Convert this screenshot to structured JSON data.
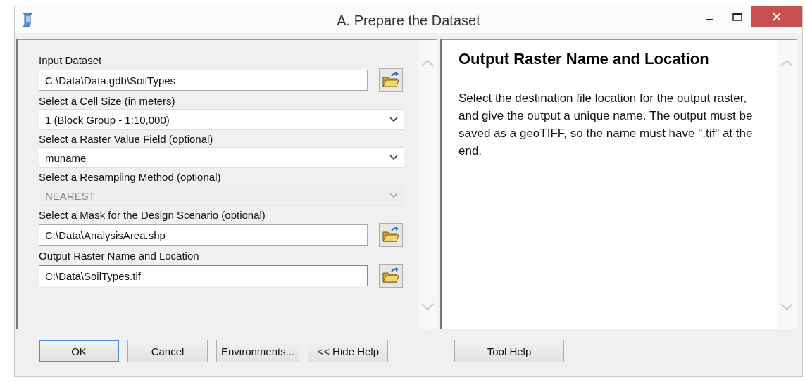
{
  "window": {
    "title": "A. Prepare the Dataset"
  },
  "parameters": [
    {
      "label": "Input Dataset",
      "kind": "file",
      "value": "C:\\Data\\Data.gdb\\SoilTypes",
      "disabled": false,
      "focused": false
    },
    {
      "label": "Select a Cell Size (in meters)",
      "kind": "dropdown",
      "value": "1 (Block Group - 1:10,000)",
      "disabled": false,
      "focused": false
    },
    {
      "label": "Select a Raster Value Field (optional)",
      "kind": "dropdown",
      "value": "muname",
      "disabled": false,
      "focused": false
    },
    {
      "label": "Select a Resampling Method (optional)",
      "kind": "dropdown",
      "value": "NEAREST",
      "disabled": true,
      "focused": false
    },
    {
      "label": "Select a Mask for the Design Scenario (optional)",
      "kind": "file",
      "value": "C:\\Data\\AnalysisArea.shp",
      "disabled": false,
      "focused": false
    },
    {
      "label": "Output Raster Name and Location",
      "kind": "file",
      "value": "C:\\Data\\SoilTypes.tif",
      "disabled": false,
      "focused": true
    }
  ],
  "help": {
    "title": "Output Raster Name and Location",
    "text": "Select the destination file location for the output raster, and give the output a unique name. The output must be saved as a geoTIFF, so the name must have \".tif\" at the end."
  },
  "buttons": [
    {
      "label": "OK",
      "default": true
    },
    {
      "label": "Cancel",
      "default": false
    },
    {
      "label": "Environments...",
      "default": false
    },
    {
      "label": "<< Hide Help",
      "default": false
    }
  ],
  "help_buttons": [
    {
      "label": "Tool Help",
      "default": false
    }
  ]
}
